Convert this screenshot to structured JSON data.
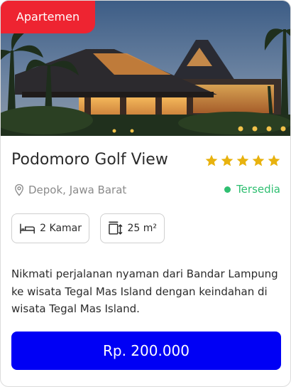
{
  "badge": {
    "label": "Apartemen"
  },
  "property": {
    "title": "Podomoro Golf View",
    "rating": 5,
    "location": "Depok, Jawa Barat",
    "status": "Tersedia",
    "rooms": "2 Kamar",
    "area": "25 m²",
    "description": "Nikmati perjalanan nyaman dari Bandar Lampung ke wisata Tegal Mas Island dengan keindahan di wisata Tegal Mas Island.",
    "price": "Rp. 200.000"
  },
  "colors": {
    "badge": "#ee2431",
    "star": "#e8b20e",
    "status": "#2fbf71",
    "button": "#0000f5"
  },
  "icons": [
    "map-pin-icon",
    "status-dot-icon",
    "bed-icon",
    "area-icon",
    "star-icon"
  ]
}
